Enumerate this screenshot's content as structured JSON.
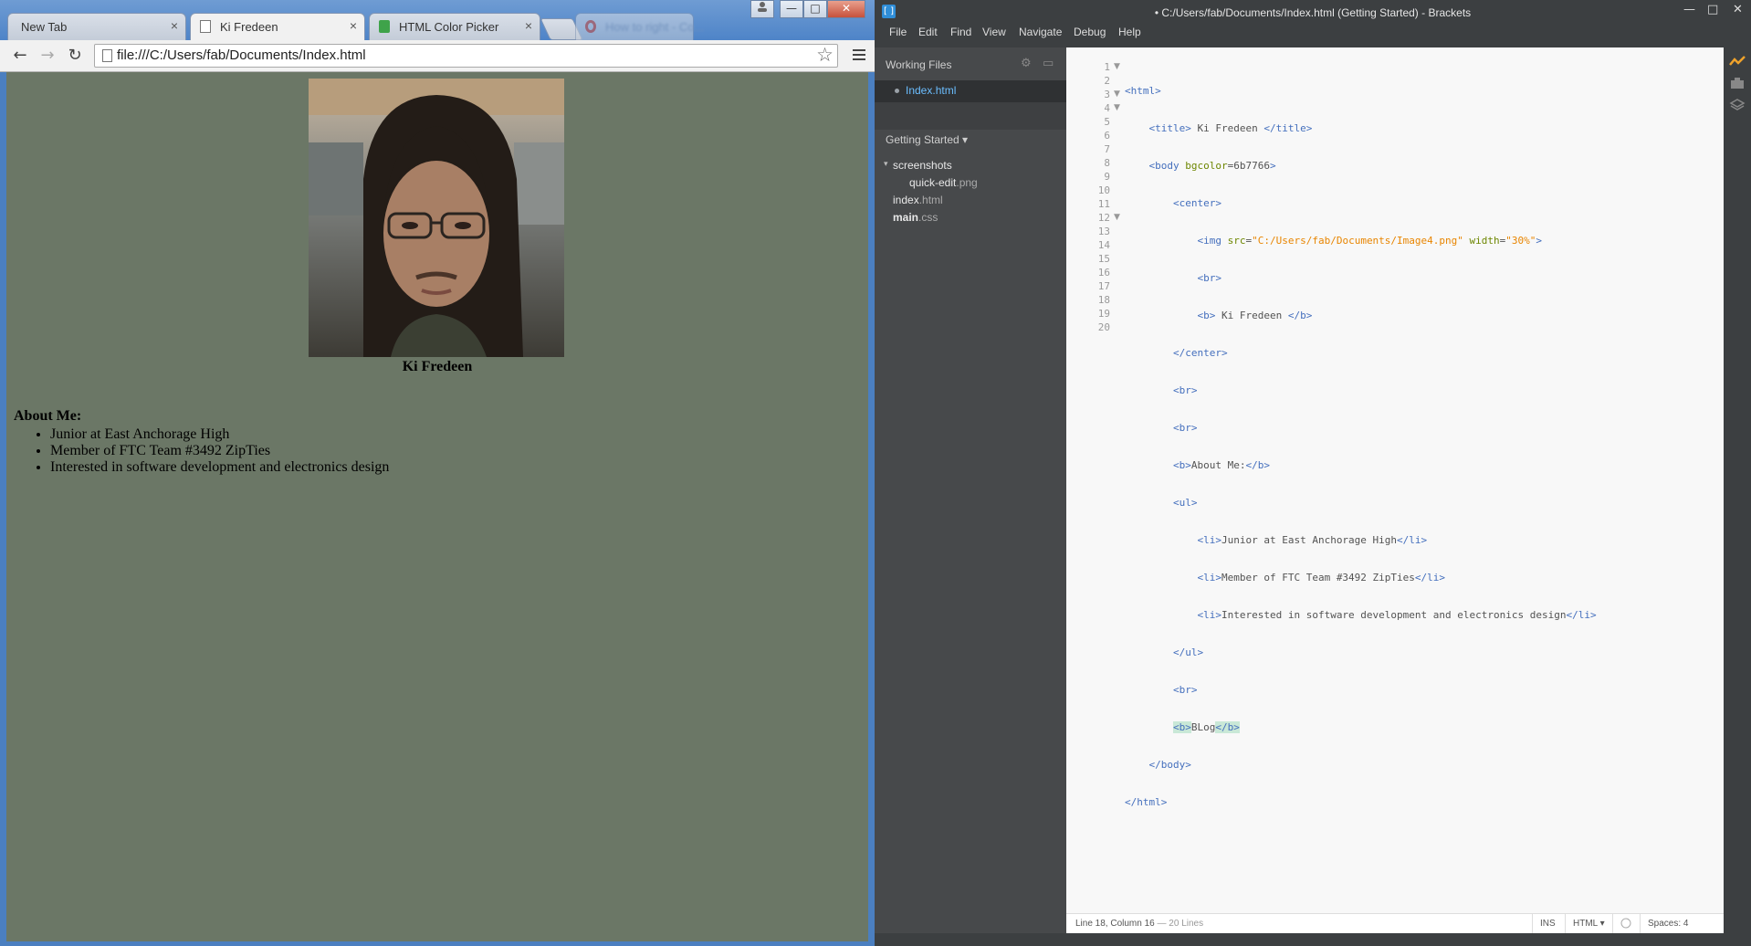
{
  "browser": {
    "tabs": [
      {
        "label": "New Tab",
        "close": "×"
      },
      {
        "label": "Ki Fredeen",
        "close": "×"
      },
      {
        "label": "HTML Color Picker",
        "close": "×"
      },
      {
        "label": "How to right - Co...",
        "close": ""
      }
    ],
    "window_controls": {
      "minimize": "—",
      "maximize": "□",
      "close": "✕"
    },
    "toolbar": {
      "back": "←",
      "forward": "→",
      "reload": "↻",
      "star": "☆"
    },
    "url": "file:///C:/Users/fab/Documents/Index.html",
    "page": {
      "background": "#6b7766",
      "name": "Ki Fredeen",
      "about_heading": "About Me:",
      "items": [
        "Junior at East Anchorage High",
        "Member of FTC Team #3492 ZipTies",
        "Interested in software development and electronics design"
      ]
    }
  },
  "editor": {
    "title": "• C:/Users/fab/Documents/Index.html (Getting Started) - Brackets",
    "window_controls": {
      "minimize": "—",
      "maximize": "□",
      "close": "✕"
    },
    "menu": [
      "File",
      "Edit",
      "Find",
      "View",
      "Navigate",
      "Debug",
      "Help"
    ],
    "sidebar": {
      "working_files_label": "Working Files",
      "working_file": "Index.html",
      "project_label": "Getting Started ▾",
      "tree": {
        "folder": "screenshots",
        "folder_file": {
          "name": "quick-edit",
          "ext": ".png"
        },
        "files": [
          {
            "name": "index",
            "ext": ".html"
          },
          {
            "name": "main",
            "ext": ".css"
          }
        ]
      }
    },
    "line_numbers": [
      "1",
      "2",
      "3",
      "4",
      "5",
      "6",
      "7",
      "8",
      "9",
      "10",
      "11",
      "12",
      "13",
      "14",
      "15",
      "16",
      "17",
      "18",
      "19",
      "20"
    ],
    "code": {
      "l1": "<html>",
      "l2a": "<title>",
      "l2b": " Ki Fredeen ",
      "l2c": "</title>",
      "l3a": "<body ",
      "l3b": "bgcolor",
      "l3c": "=6b7766",
      "l3d": ">",
      "l4": "<center>",
      "l5a": "<img ",
      "l5b": "src",
      "l5c": "=",
      "l5d": "\"C:/Users/fab/Documents/Image4.png\"",
      "l5e": " width",
      "l5f": "=",
      "l5g": "\"30%\"",
      "l5h": ">",
      "l6": "<br>",
      "l7a": "<b>",
      "l7b": " Ki Fredeen ",
      "l7c": "</b>",
      "l8": "</center>",
      "l9": "<br>",
      "l10": "<br>",
      "l11a": "<b>",
      "l11b": "About Me:",
      "l11c": "</b>",
      "l12": "<ul>",
      "l13a": "<li>",
      "l13b": "Junior at East Anchorage High",
      "l13c": "</li>",
      "l14a": "<li>",
      "l14b": "Member of FTC Team #3492 ZipTies",
      "l14c": "</li>",
      "l15a": "<li>",
      "l15b": "Interested in software development and electronics design",
      "l15c": "</li>",
      "l16": "</ul>",
      "l17": "<br>",
      "l18a": "<b>",
      "l18b": "BLog",
      "l18c": "</b>",
      "l19": "</body>",
      "l20": "</html>"
    },
    "status": {
      "position": "Line 18, Column 16",
      "lines": "— 20 Lines",
      "mode": "INS",
      "language": "HTML ▾",
      "spaces": "Spaces:  4"
    }
  }
}
